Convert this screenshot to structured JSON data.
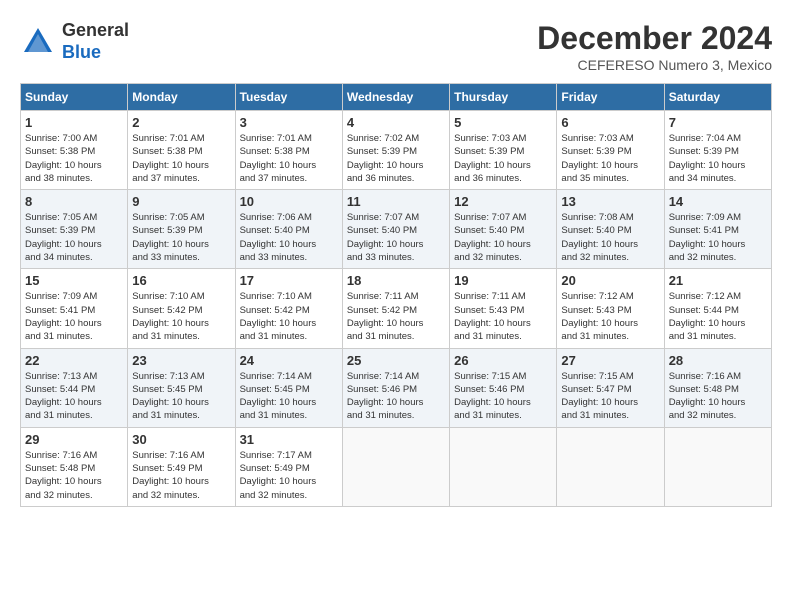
{
  "header": {
    "logo_line1": "General",
    "logo_line2": "Blue",
    "month": "December 2024",
    "location": "CEFERESO Numero 3, Mexico"
  },
  "days_of_week": [
    "Sunday",
    "Monday",
    "Tuesday",
    "Wednesday",
    "Thursday",
    "Friday",
    "Saturday"
  ],
  "weeks": [
    [
      {
        "day": "1",
        "info": "Sunrise: 7:00 AM\nSunset: 5:38 PM\nDaylight: 10 hours\nand 38 minutes."
      },
      {
        "day": "2",
        "info": "Sunrise: 7:01 AM\nSunset: 5:38 PM\nDaylight: 10 hours\nand 37 minutes."
      },
      {
        "day": "3",
        "info": "Sunrise: 7:01 AM\nSunset: 5:38 PM\nDaylight: 10 hours\nand 37 minutes."
      },
      {
        "day": "4",
        "info": "Sunrise: 7:02 AM\nSunset: 5:39 PM\nDaylight: 10 hours\nand 36 minutes."
      },
      {
        "day": "5",
        "info": "Sunrise: 7:03 AM\nSunset: 5:39 PM\nDaylight: 10 hours\nand 36 minutes."
      },
      {
        "day": "6",
        "info": "Sunrise: 7:03 AM\nSunset: 5:39 PM\nDaylight: 10 hours\nand 35 minutes."
      },
      {
        "day": "7",
        "info": "Sunrise: 7:04 AM\nSunset: 5:39 PM\nDaylight: 10 hours\nand 34 minutes."
      }
    ],
    [
      {
        "day": "8",
        "info": "Sunrise: 7:05 AM\nSunset: 5:39 PM\nDaylight: 10 hours\nand 34 minutes."
      },
      {
        "day": "9",
        "info": "Sunrise: 7:05 AM\nSunset: 5:39 PM\nDaylight: 10 hours\nand 33 minutes."
      },
      {
        "day": "10",
        "info": "Sunrise: 7:06 AM\nSunset: 5:40 PM\nDaylight: 10 hours\nand 33 minutes."
      },
      {
        "day": "11",
        "info": "Sunrise: 7:07 AM\nSunset: 5:40 PM\nDaylight: 10 hours\nand 33 minutes."
      },
      {
        "day": "12",
        "info": "Sunrise: 7:07 AM\nSunset: 5:40 PM\nDaylight: 10 hours\nand 32 minutes."
      },
      {
        "day": "13",
        "info": "Sunrise: 7:08 AM\nSunset: 5:40 PM\nDaylight: 10 hours\nand 32 minutes."
      },
      {
        "day": "14",
        "info": "Sunrise: 7:09 AM\nSunset: 5:41 PM\nDaylight: 10 hours\nand 32 minutes."
      }
    ],
    [
      {
        "day": "15",
        "info": "Sunrise: 7:09 AM\nSunset: 5:41 PM\nDaylight: 10 hours\nand 31 minutes."
      },
      {
        "day": "16",
        "info": "Sunrise: 7:10 AM\nSunset: 5:42 PM\nDaylight: 10 hours\nand 31 minutes."
      },
      {
        "day": "17",
        "info": "Sunrise: 7:10 AM\nSunset: 5:42 PM\nDaylight: 10 hours\nand 31 minutes."
      },
      {
        "day": "18",
        "info": "Sunrise: 7:11 AM\nSunset: 5:42 PM\nDaylight: 10 hours\nand 31 minutes."
      },
      {
        "day": "19",
        "info": "Sunrise: 7:11 AM\nSunset: 5:43 PM\nDaylight: 10 hours\nand 31 minutes."
      },
      {
        "day": "20",
        "info": "Sunrise: 7:12 AM\nSunset: 5:43 PM\nDaylight: 10 hours\nand 31 minutes."
      },
      {
        "day": "21",
        "info": "Sunrise: 7:12 AM\nSunset: 5:44 PM\nDaylight: 10 hours\nand 31 minutes."
      }
    ],
    [
      {
        "day": "22",
        "info": "Sunrise: 7:13 AM\nSunset: 5:44 PM\nDaylight: 10 hours\nand 31 minutes."
      },
      {
        "day": "23",
        "info": "Sunrise: 7:13 AM\nSunset: 5:45 PM\nDaylight: 10 hours\nand 31 minutes."
      },
      {
        "day": "24",
        "info": "Sunrise: 7:14 AM\nSunset: 5:45 PM\nDaylight: 10 hours\nand 31 minutes."
      },
      {
        "day": "25",
        "info": "Sunrise: 7:14 AM\nSunset: 5:46 PM\nDaylight: 10 hours\nand 31 minutes."
      },
      {
        "day": "26",
        "info": "Sunrise: 7:15 AM\nSunset: 5:46 PM\nDaylight: 10 hours\nand 31 minutes."
      },
      {
        "day": "27",
        "info": "Sunrise: 7:15 AM\nSunset: 5:47 PM\nDaylight: 10 hours\nand 31 minutes."
      },
      {
        "day": "28",
        "info": "Sunrise: 7:16 AM\nSunset: 5:48 PM\nDaylight: 10 hours\nand 32 minutes."
      }
    ],
    [
      {
        "day": "29",
        "info": "Sunrise: 7:16 AM\nSunset: 5:48 PM\nDaylight: 10 hours\nand 32 minutes."
      },
      {
        "day": "30",
        "info": "Sunrise: 7:16 AM\nSunset: 5:49 PM\nDaylight: 10 hours\nand 32 minutes."
      },
      {
        "day": "31",
        "info": "Sunrise: 7:17 AM\nSunset: 5:49 PM\nDaylight: 10 hours\nand 32 minutes."
      },
      {
        "day": "",
        "info": ""
      },
      {
        "day": "",
        "info": ""
      },
      {
        "day": "",
        "info": ""
      },
      {
        "day": "",
        "info": ""
      }
    ]
  ]
}
